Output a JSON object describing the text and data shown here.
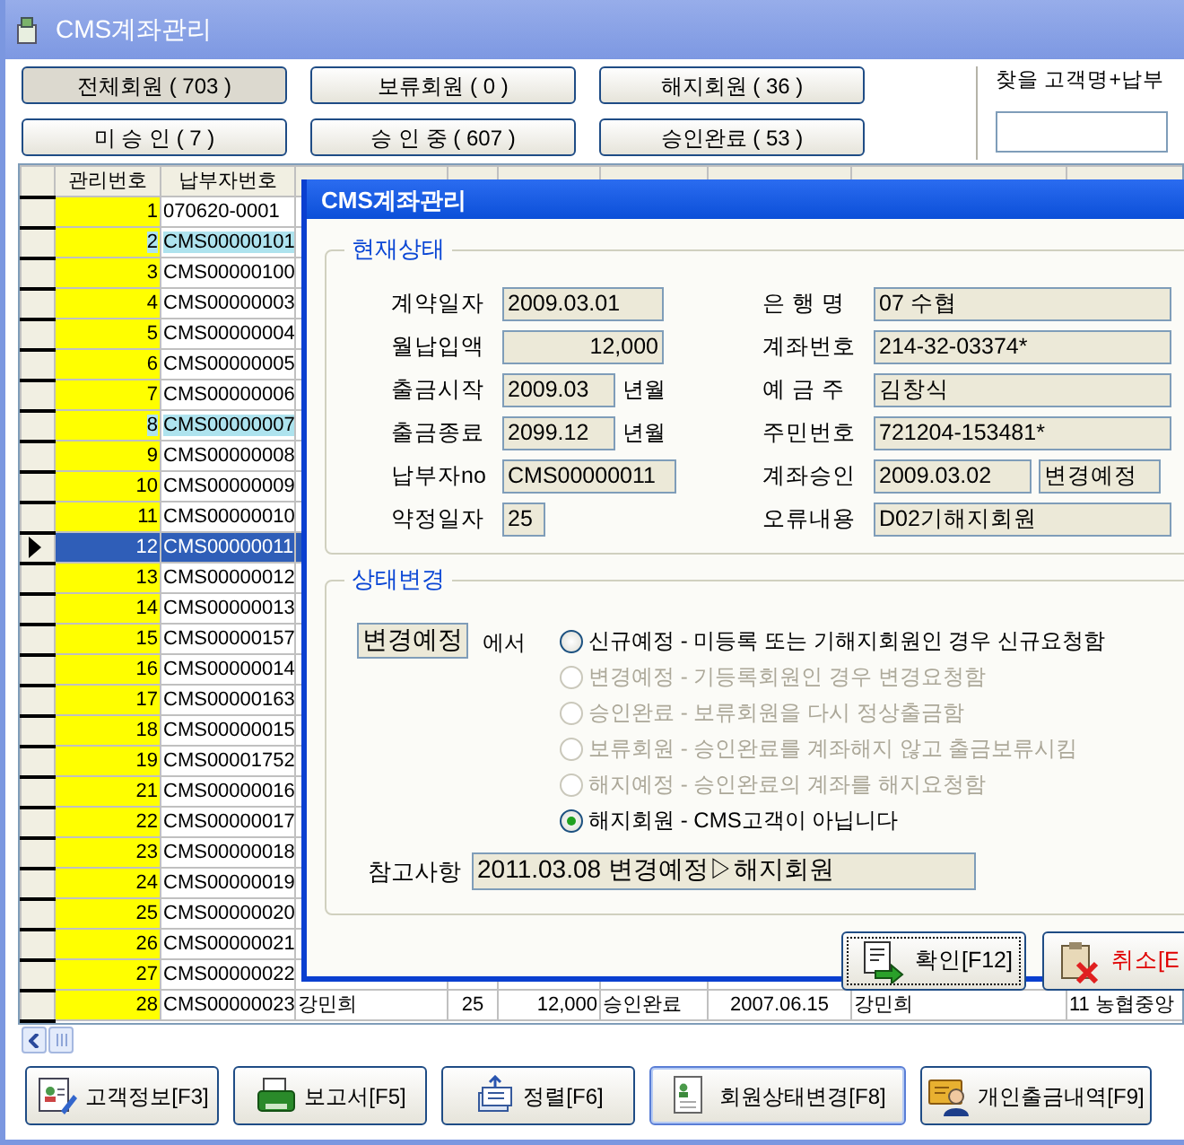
{
  "window": {
    "title": "CMS계좌관리"
  },
  "filter_buttons": [
    {
      "label": "전체회원 ( 703 )",
      "selected": true
    },
    {
      "label": "보류회원 ( 0 )",
      "selected": false
    },
    {
      "label": "해지회원 ( 36 )",
      "selected": false
    },
    {
      "label": "미 승 인 ( 7 )",
      "selected": false
    },
    {
      "label": "승 인 중 ( 607 )",
      "selected": false
    },
    {
      "label": "승인완료 ( 53 )",
      "selected": false
    }
  ],
  "search": {
    "label": "찾을 고객명+납부"
  },
  "table": {
    "columns": [
      "관리번호",
      "납부자번호"
    ],
    "rows": [
      {
        "cells": [
          "1",
          "070620-0001"
        ],
        "marked": false,
        "selected": false
      },
      {
        "cells": [
          "2",
          "CMS00000101"
        ],
        "marked": true,
        "selected": false
      },
      {
        "cells": [
          "3",
          "CMS00000100"
        ],
        "marked": false,
        "selected": false
      },
      {
        "cells": [
          "4",
          "CMS00000003"
        ],
        "marked": false,
        "selected": false
      },
      {
        "cells": [
          "5",
          "CMS00000004"
        ],
        "marked": false,
        "selected": false
      },
      {
        "cells": [
          "6",
          "CMS00000005"
        ],
        "marked": false,
        "selected": false
      },
      {
        "cells": [
          "7",
          "CMS00000006"
        ],
        "marked": false,
        "selected": false
      },
      {
        "cells": [
          "8",
          "CMS00000007"
        ],
        "marked": true,
        "selected": false
      },
      {
        "cells": [
          "9",
          "CMS00000008"
        ],
        "marked": false,
        "selected": false
      },
      {
        "cells": [
          "10",
          "CMS00000009"
        ],
        "marked": false,
        "selected": false
      },
      {
        "cells": [
          "11",
          "CMS00000010"
        ],
        "marked": false,
        "selected": false
      },
      {
        "cells": [
          "12",
          "CMS00000011"
        ],
        "marked": false,
        "selected": true
      },
      {
        "cells": [
          "13",
          "CMS00000012"
        ],
        "marked": false,
        "selected": false
      },
      {
        "cells": [
          "14",
          "CMS00000013"
        ],
        "marked": false,
        "selected": false
      },
      {
        "cells": [
          "15",
          "CMS00000157"
        ],
        "marked": false,
        "selected": false
      },
      {
        "cells": [
          "16",
          "CMS00000014"
        ],
        "marked": false,
        "selected": false
      },
      {
        "cells": [
          "17",
          "CMS00000163"
        ],
        "marked": false,
        "selected": false
      },
      {
        "cells": [
          "18",
          "CMS00000015"
        ],
        "marked": false,
        "selected": false
      },
      {
        "cells": [
          "19",
          "CMS00001752"
        ],
        "marked": false,
        "selected": false
      },
      {
        "cells": [
          "21",
          "CMS00000016"
        ],
        "marked": false,
        "selected": false
      },
      {
        "cells": [
          "22",
          "CMS00000017"
        ],
        "marked": false,
        "selected": false
      },
      {
        "cells": [
          "23",
          "CMS00000018"
        ],
        "marked": false,
        "selected": false
      },
      {
        "cells": [
          "24",
          "CMS00000019"
        ],
        "marked": false,
        "selected": false
      },
      {
        "cells": [
          "25",
          "CMS00000020"
        ],
        "marked": false,
        "selected": false
      },
      {
        "cells": [
          "26",
          "CMS00000021"
        ],
        "marked": false,
        "selected": false
      },
      {
        "cells": [
          "27",
          "CMS00000022"
        ],
        "marked": false,
        "selected": false
      },
      {
        "cells": [
          "28",
          "CMS00000023",
          "강민희",
          "25",
          "12,000",
          "승인완료",
          "2007.06.15",
          "강민희",
          "11 농협중앙"
        ],
        "marked": false,
        "selected": false
      }
    ]
  },
  "dialog": {
    "title": "CMS계좌관리",
    "current_status": {
      "title": "현재상태",
      "left_fields": [
        {
          "label": "계약일자",
          "value": "2009.03.01",
          "kind": "text"
        },
        {
          "label": "월납입액",
          "value": "12,000",
          "kind": "amount"
        },
        {
          "label": "출금시작",
          "value": "2009.03",
          "kind": "month",
          "suffix": "년월"
        },
        {
          "label": "출금종료",
          "value": "2099.12",
          "kind": "month",
          "suffix": "년월"
        },
        {
          "label": "납부자no",
          "value": "CMS00000011",
          "kind": "code"
        },
        {
          "label": "약정일자",
          "value": "25",
          "kind": "day"
        }
      ],
      "right_fields": [
        {
          "label": "은 행 명",
          "values": [
            "07 수협"
          ]
        },
        {
          "label": "계좌번호",
          "values": [
            "214-32-03374*"
          ]
        },
        {
          "label": "예 금 주",
          "values": [
            "김창식"
          ]
        },
        {
          "label": "주민번호",
          "values": [
            "721204-153481*"
          ]
        },
        {
          "label": "계좌승인",
          "values": [
            "2009.03.02",
            "변경예정"
          ]
        },
        {
          "label": "오류내용",
          "values": [
            "D02기해지회원"
          ]
        }
      ]
    },
    "status_change": {
      "title": "상태변경",
      "from_value": "변경예정",
      "from_suffix": "에서",
      "options": [
        {
          "label": "신규예정 - 미등록 또는 기해지회원인 경우 신규요청함",
          "selected": false,
          "disabled": false
        },
        {
          "label": "변경예정 - 기등록회원인 경우 변경요청함",
          "selected": false,
          "disabled": true
        },
        {
          "label": "승인완료 - 보류회원을 다시 정상출금함",
          "selected": false,
          "disabled": true
        },
        {
          "label": "보류회원 - 승인완료를 계좌해지 않고 출금보류시킴",
          "selected": false,
          "disabled": true
        },
        {
          "label": "해지예정 - 승인완료의 계좌를 해지요청함",
          "selected": false,
          "disabled": true
        },
        {
          "label": "해지회원 - CMS고객이 아닙니다",
          "selected": true,
          "disabled": false
        }
      ],
      "note": {
        "label": "참고사항",
        "value": "2011.03.08 변경예정▷해지회원"
      }
    },
    "buttons": [
      {
        "label": "확인[F12]",
        "kind": "ok"
      },
      {
        "label": "취소[E",
        "kind": "cancel"
      }
    ]
  },
  "toolbar": [
    {
      "label": "고객정보[F3]",
      "kind": "customer",
      "focused": false
    },
    {
      "label": "보고서[F5]",
      "kind": "report",
      "focused": false
    },
    {
      "label": "정렬[F6]",
      "kind": "sort",
      "focused": false
    },
    {
      "label": "회원상태변경[F8]",
      "kind": "status",
      "focused": true
    },
    {
      "label": "개인출금내역[F9]",
      "kind": "history",
      "focused": false
    }
  ]
}
